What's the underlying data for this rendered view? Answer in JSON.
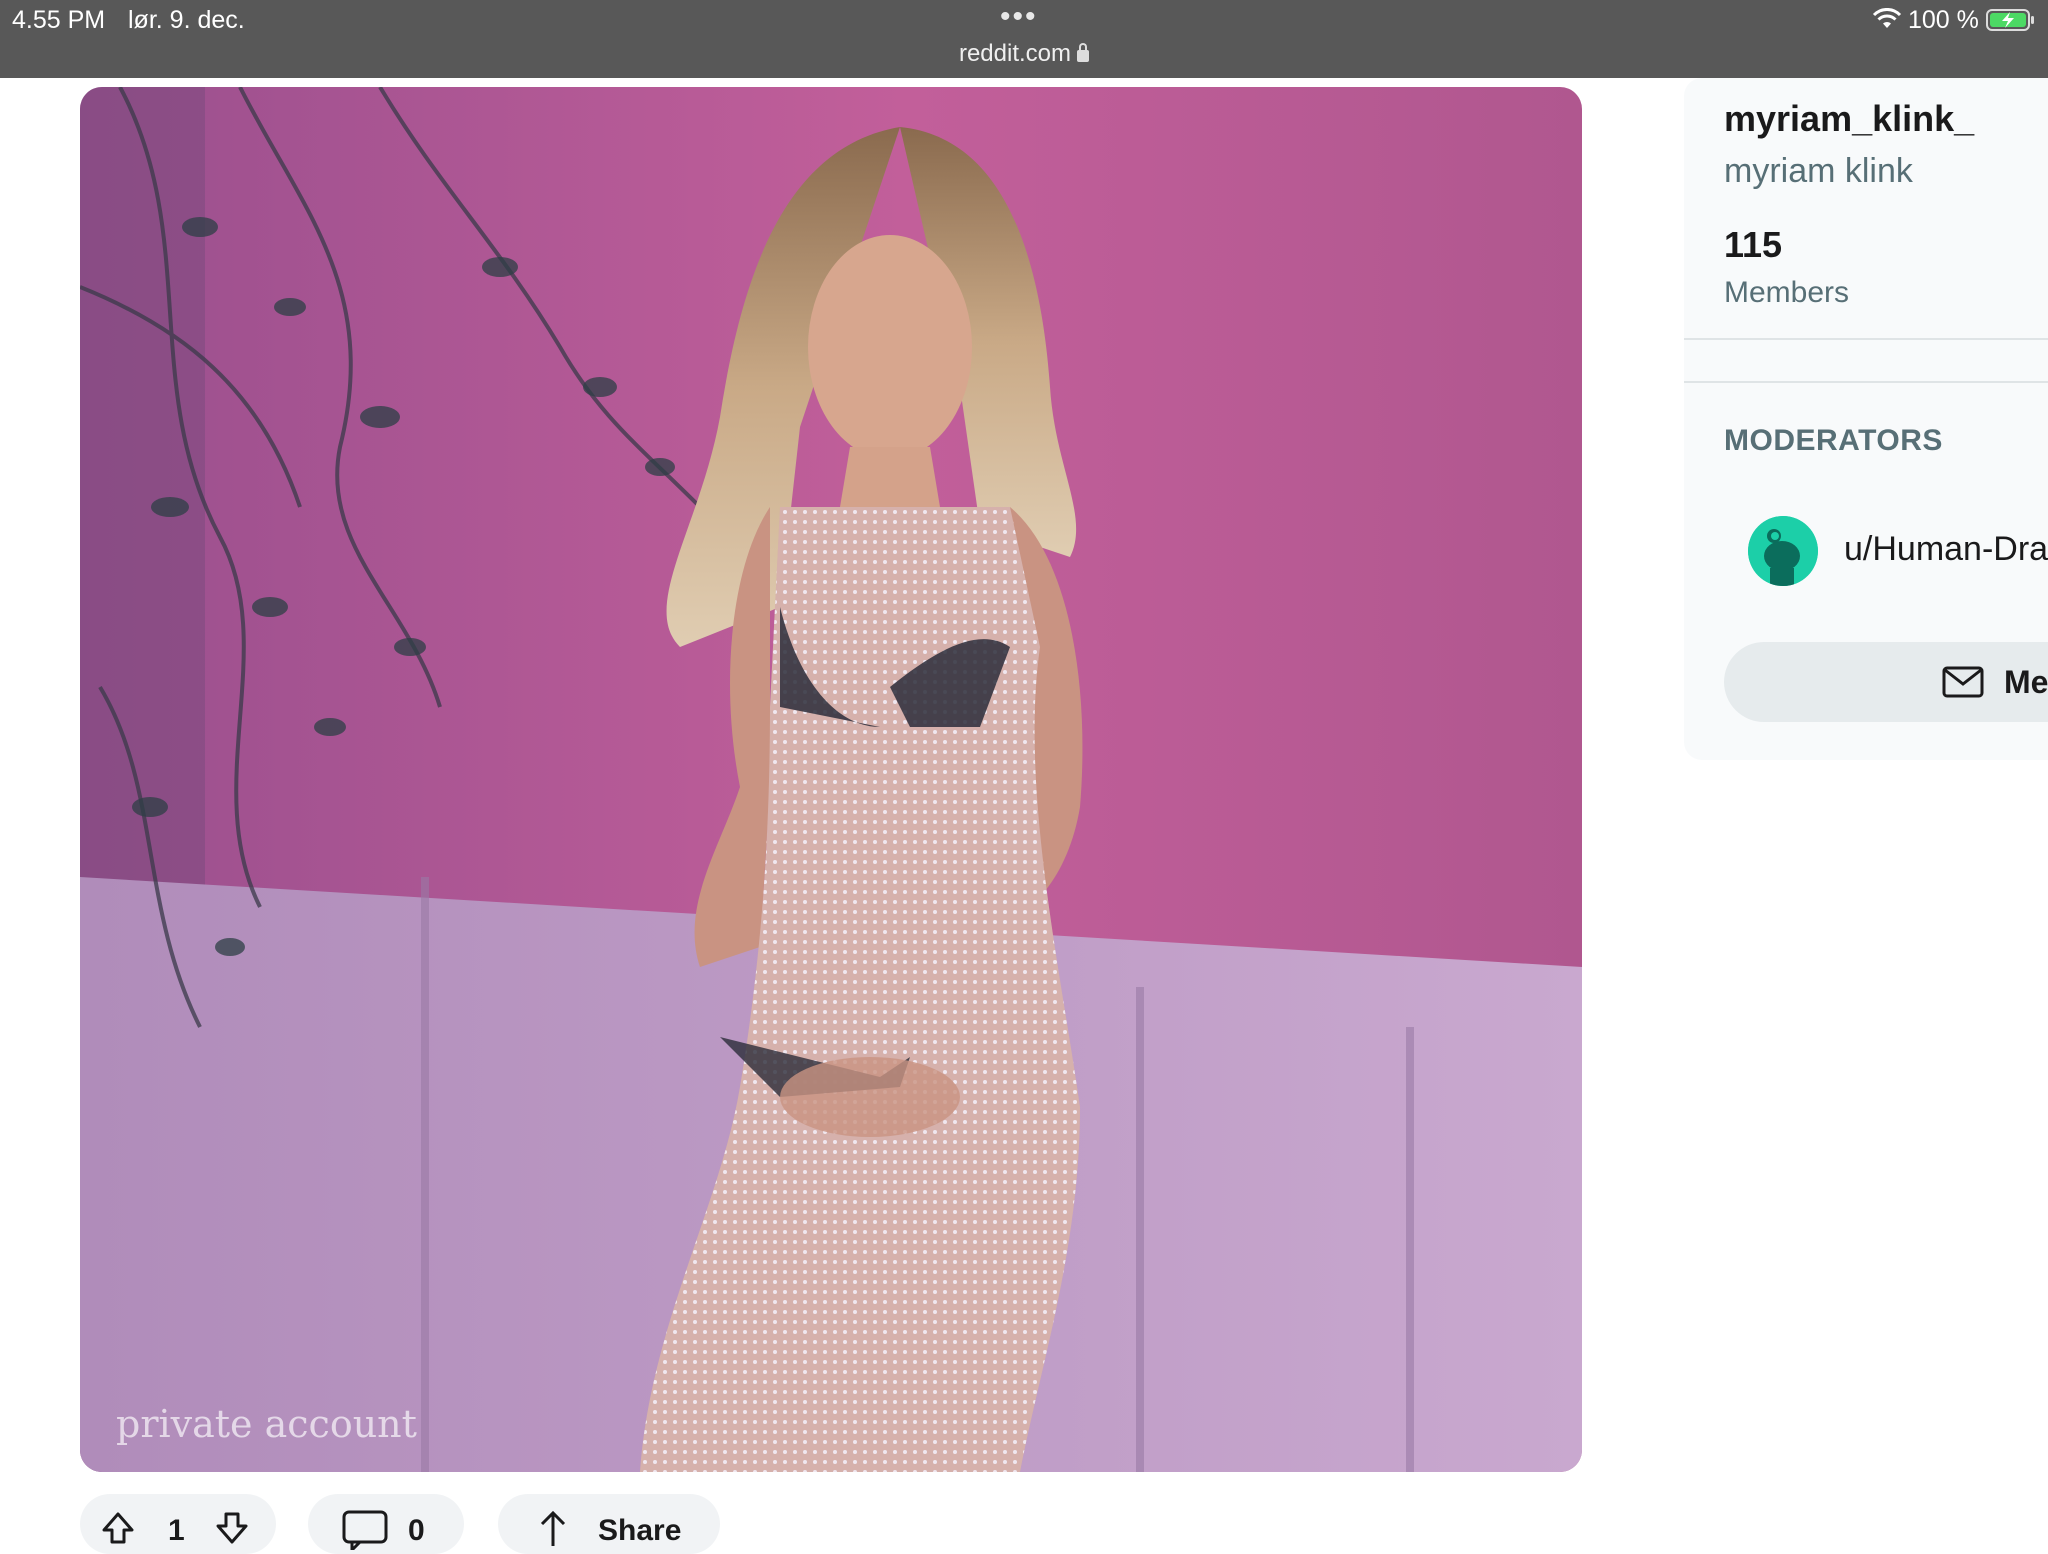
{
  "status_bar": {
    "time": "4.55 PM",
    "date": "lør. 9. dec.",
    "dots": "•••",
    "url": "reddit.com",
    "battery_percent": "100 %"
  },
  "post": {
    "watermark": "private account",
    "actions": {
      "vote_count": "1",
      "comment_count": "0",
      "share_label": "Share"
    }
  },
  "sidebar": {
    "community_name": "myriam_klink_",
    "community_title": "myriam klink",
    "member_count": "115",
    "member_label": "Members",
    "moderators_heading": "MODERATORS",
    "moderator": "u/Human-Dra",
    "message_button_label": "Me"
  },
  "colors": {
    "status_bar_bg": "#585858",
    "sidebar_bg": "#f8fafb",
    "pill_bg": "#f1f3f5",
    "avatar_bg": "#1ccfa8",
    "battery_fill": "#4cd964"
  }
}
